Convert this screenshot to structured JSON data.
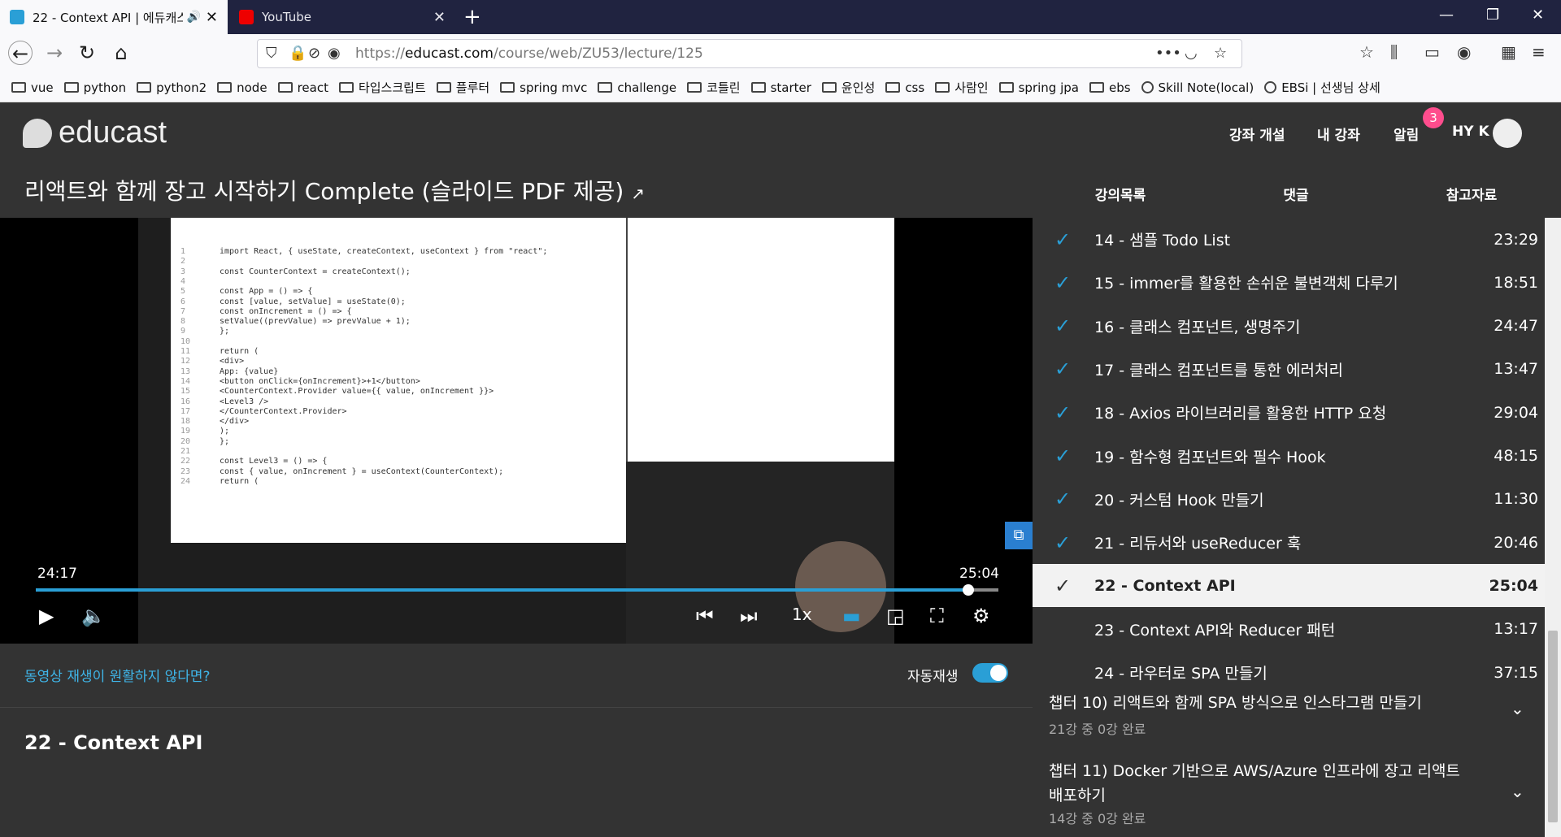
{
  "browser": {
    "tabs": [
      {
        "title": "22 - Context API | 에듀캐스",
        "active": true
      },
      {
        "title": "YouTube",
        "active": false
      }
    ],
    "url_prefix": "https://",
    "url_domain": "educast.com",
    "url_path": "/course/web/ZU53/lecture/125",
    "bookmarks": [
      "vue",
      "python",
      "python2",
      "node",
      "react",
      "타입스크립트",
      "플루터",
      "spring mvc",
      "challenge",
      "코틀린",
      "starter",
      "윤인성",
      "css",
      "사람인",
      "spring jpa",
      "ebs",
      "Skill Note(local)",
      "EBSi | 선생님 상세"
    ]
  },
  "site": {
    "logo": "educast",
    "nav": {
      "create": "강좌 개설",
      "my": "내 강좌",
      "alerts": "알림",
      "alert_count": "3",
      "user": "HY K"
    },
    "course_title": "리액트와 함께 장고 시작하기 Complete (슬라이드 PDF 제공)",
    "side_tabs": [
      "강의목록",
      "댓글",
      "참고자료"
    ]
  },
  "video": {
    "current_time": "24:17",
    "duration": "25:04",
    "progress": 0.969,
    "speed": "1x",
    "code_lines": [
      "import React, { useState, createContext, useContext } from \"react\";",
      "",
      "const CounterContext = createContext();",
      "",
      "const App = () => {",
      "  const [value, setValue] = useState(0);",
      "  const onIncrement = () => {",
      "    setValue((prevValue) => prevValue + 1);",
      "  };",
      "",
      "  return (",
      "    <div>",
      "      App: {value}",
      "      <button onClick={onIncrement}>+1</button>",
      "      <CounterContext.Provider value={{ value, onIncrement }}>",
      "        <Level3 />",
      "      </CounterContext.Provider>",
      "    </div>",
      "  );",
      "};",
      "",
      "const Level3 = () => {",
      "  const { value, onIncrement } = useContext(CounterContext);",
      "  return ("
    ]
  },
  "below": {
    "help": "동영상 재생이 원활하지 않다면?",
    "autoplay": "자동재생",
    "lecture_title": "22 - Context API"
  },
  "lectures": [
    {
      "name": "14 - 샘플 Todo List",
      "dur": "23:29",
      "done": true
    },
    {
      "name": "15 - immer를 활용한 손쉬운 불변객체 다루기",
      "dur": "18:51",
      "done": true
    },
    {
      "name": "16 - 클래스 컴포넌트, 생명주기",
      "dur": "24:47",
      "done": true
    },
    {
      "name": "17 - 클래스 컴포넌트를 통한 에러처리",
      "dur": "13:47",
      "done": true
    },
    {
      "name": "18 - Axios 라이브러리를 활용한 HTTP 요청",
      "dur": "29:04",
      "done": true
    },
    {
      "name": "19 - 함수형 컴포넌트와 필수 Hook",
      "dur": "48:15",
      "done": true
    },
    {
      "name": "20 - 커스텀 Hook 만들기",
      "dur": "11:30",
      "done": true
    },
    {
      "name": "21 - 리듀서와 useReducer 훅",
      "dur": "20:46",
      "done": true
    },
    {
      "name": "22 - Context API",
      "dur": "25:04",
      "done": true,
      "current": true
    },
    {
      "name": "23 - Context API와 Reducer 패턴",
      "dur": "13:17",
      "done": false
    },
    {
      "name": "24 - 라우터로 SPA 만들기",
      "dur": "37:15",
      "done": false
    }
  ],
  "chapters": [
    {
      "title": "챕터 10) 리액트와 함께 SPA 방식으로 인스타그램 만들기",
      "sub": "21강 중 0강 완료"
    },
    {
      "title": "챕터 11) Docker 기반으로 AWS/Azure 인프라에 장고 리액트 배포하기",
      "sub": "14강 중 0강 완료"
    }
  ]
}
